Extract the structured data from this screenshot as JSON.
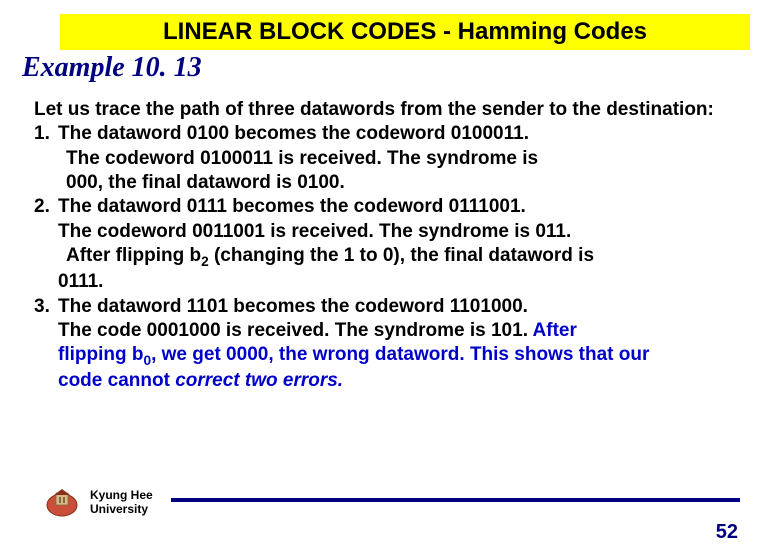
{
  "title": "LINEAR BLOCK CODES - Hamming Codes",
  "example_label": "Example 10. 13",
  "intro": "Let us trace the path of three datawords from the sender to the destination:",
  "items": [
    {
      "num": "1.",
      "line1": "The dataword 0100 becomes the codeword 0100011.",
      "line2": "The codeword 0100011 is received. The syndrome is",
      "line3": "000, the final dataword is 0100."
    },
    {
      "num": "2.",
      "line1": "The dataword 0111 becomes the codeword 0111001.",
      "line2a": "The codeword 0011001 is received. The syndrome is 011.",
      "line3_pre": "After  flipping b",
      "line3_sub": "2",
      "line3_post": " (changing the 1 to 0), the final dataword is",
      "line4": "0111."
    },
    {
      "num": "3.",
      "line1": "The dataword 1101 becomes the codeword 1101000.",
      "line2_pre": "The code 0001000 is received. The syndrome is 101. ",
      "line2_blue": "After",
      "line3_pre": "flipping b",
      "line3_sub": "0",
      "line3_mid": ", we get 0000, the wrong dataword. ",
      "line3_post": "This shows that our",
      "line4_a": "code cannot ",
      "line4_b": "correct two errors."
    }
  ],
  "footer": {
    "university_line1": "Kyung Hee",
    "university_line2": "University",
    "page": "52"
  }
}
